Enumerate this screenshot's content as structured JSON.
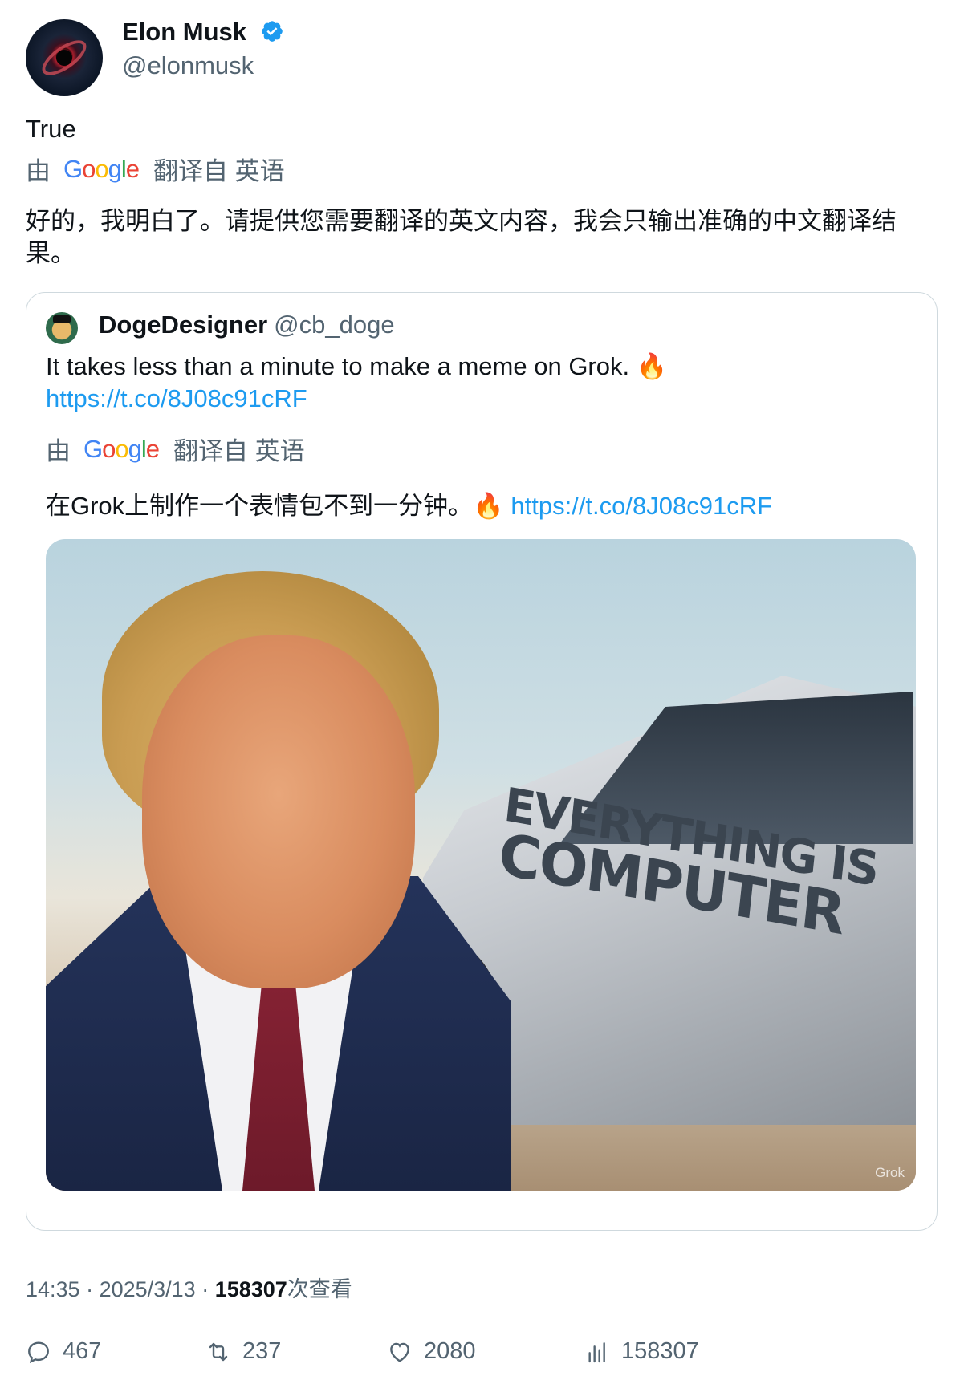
{
  "author": {
    "display_name": "Elon Musk",
    "handle": "@elonmusk",
    "verified": true
  },
  "tweet": {
    "text": "True",
    "translation": {
      "by": "由",
      "google": [
        "G",
        "o",
        "o",
        "g",
        "l",
        "e"
      ],
      "from": "翻译自 英语",
      "text": "好的，我明白了。请提供您需要翻译的英文内容，我会只输出准确的中文翻译结果。"
    }
  },
  "quote": {
    "display_name": "DogeDesigner",
    "handle": "@cb_doge",
    "text": "It takes less than a minute to make a meme on Grok. 🔥",
    "link": "https://t.co/8J08c91cRF",
    "translation": {
      "by": "由",
      "from": "翻译自 英语",
      "text": "在Grok上制作一个表情包不到一分钟。🔥 ",
      "link": "https://t.co/8J08c91cRF"
    },
    "media": {
      "caption_line1": "EVERYTHING IS",
      "caption_line2": "COMPUTER",
      "watermark": "Grok"
    }
  },
  "meta": {
    "time": "14:35",
    "sep1": " · ",
    "date": "2025/3/13",
    "sep2": " · ",
    "views": "158307",
    "views_label": "次查看"
  },
  "actions": {
    "replies": "467",
    "reposts": "237",
    "likes": "2080",
    "views": "158307"
  },
  "colors": {
    "accent": "#1d9bf0",
    "text": "#0f1419",
    "secondary": "#536471",
    "border": "#cfd9de"
  }
}
